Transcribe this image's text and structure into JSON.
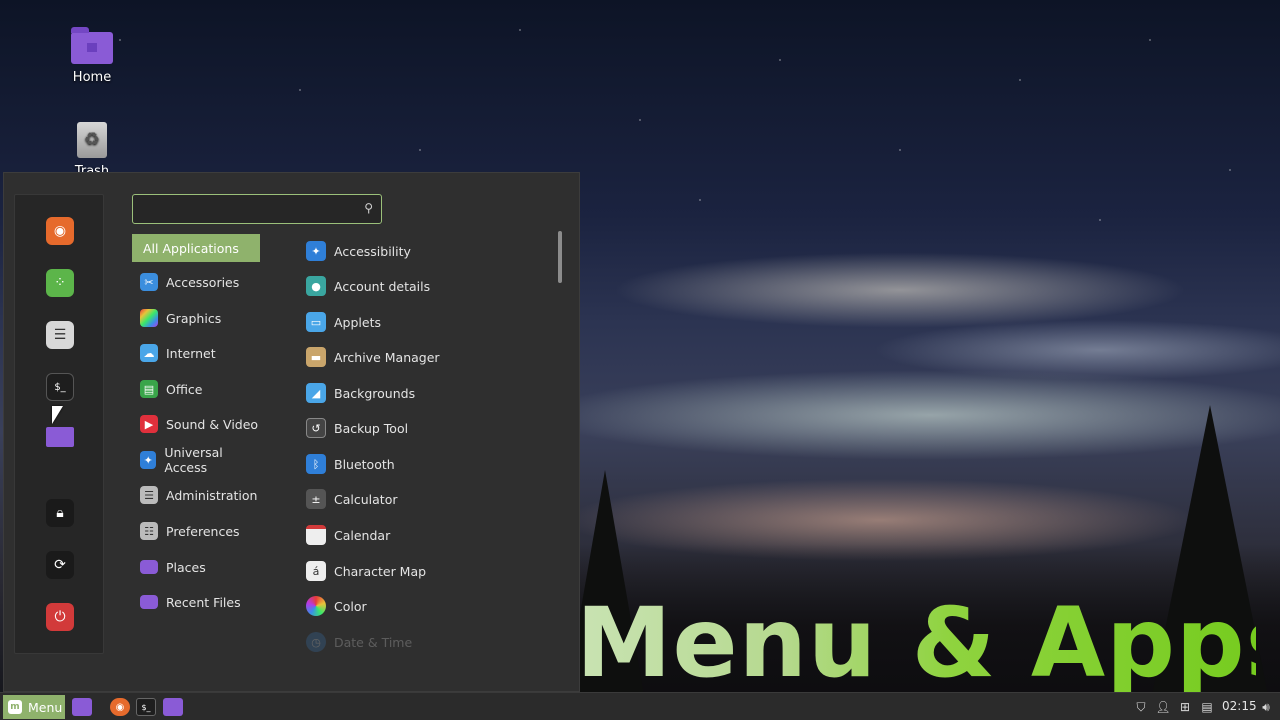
{
  "desktop": {
    "icons": [
      {
        "label": "Home",
        "icon": "folder-home-icon"
      },
      {
        "label": "Trash",
        "icon": "trash-icon"
      }
    ]
  },
  "menu": {
    "search": {
      "value": "",
      "placeholder": "",
      "icon": "search-icon"
    },
    "favorites": [
      {
        "name": "firefox",
        "icon": "firefox-icon",
        "color": "#e66a2c"
      },
      {
        "name": "software-manager",
        "icon": "software-manager-icon",
        "color": "#5cb54a"
      },
      {
        "name": "system-settings",
        "icon": "settings-icon",
        "color": "#d8d8d8"
      },
      {
        "name": "terminal",
        "icon": "terminal-icon",
        "color": "#1e1e1e"
      },
      {
        "name": "files",
        "icon": "folder-icon",
        "color": "#8a5bd6"
      },
      {
        "name": "lock-screen",
        "icon": "lock-icon",
        "color": "#1a1a1a"
      },
      {
        "name": "logout",
        "icon": "logout-icon",
        "color": "#1a1a1a"
      },
      {
        "name": "shutdown",
        "icon": "power-icon",
        "color": "#d23a3a"
      }
    ],
    "categories": [
      {
        "label": "All Applications",
        "icon": "",
        "active": true
      },
      {
        "label": "Accessories",
        "icon": "accessories-icon",
        "color": "#3b8ede"
      },
      {
        "label": "Graphics",
        "icon": "graphics-icon",
        "color": "#c04fb6"
      },
      {
        "label": "Internet",
        "icon": "internet-cloud-icon",
        "color": "#4aa6e8"
      },
      {
        "label": "Office",
        "icon": "office-icon",
        "color": "#3aa54a"
      },
      {
        "label": "Sound & Video",
        "icon": "sound-video-icon",
        "color": "#e0303c"
      },
      {
        "label": "Universal Access",
        "icon": "universal-access-icon",
        "color": "#2f7fd8"
      },
      {
        "label": "Administration",
        "icon": "administration-icon",
        "color": "#bbbbbb"
      },
      {
        "label": "Preferences",
        "icon": "preferences-icon",
        "color": "#bbbbbb"
      },
      {
        "label": "Places",
        "icon": "places-folder-icon",
        "color": "#8a5bd6"
      },
      {
        "label": "Recent Files",
        "icon": "recent-files-icon",
        "color": "#8a5bd6"
      }
    ],
    "apps": [
      {
        "label": "Accessibility",
        "icon": "accessibility-icon",
        "color": "#2f7fd8"
      },
      {
        "label": "Account details",
        "icon": "account-details-icon",
        "color": "#3aa6a0"
      },
      {
        "label": "Applets",
        "icon": "applets-icon",
        "color": "#4aa6e8"
      },
      {
        "label": "Archive Manager",
        "icon": "archive-manager-icon",
        "color": "#c9a56b"
      },
      {
        "label": "Backgrounds",
        "icon": "backgrounds-icon",
        "color": "#4aa6e8"
      },
      {
        "label": "Backup Tool",
        "icon": "backup-tool-icon",
        "color": "#444444"
      },
      {
        "label": "Bluetooth",
        "icon": "bluetooth-icon",
        "color": "#2f7fd8"
      },
      {
        "label": "Calculator",
        "icon": "calculator-icon",
        "color": "#555555"
      },
      {
        "label": "Calendar",
        "icon": "calendar-icon",
        "color": "#eeeeee"
      },
      {
        "label": "Character Map",
        "icon": "character-map-icon",
        "color": "#eeeeee"
      },
      {
        "label": "Color",
        "icon": "color-icon",
        "color": "#555555"
      },
      {
        "label": "Date & Time",
        "icon": "date-time-icon",
        "color": "#3a7bbf"
      }
    ]
  },
  "caption": {
    "text": "Menu & Apps"
  },
  "taskbar": {
    "menu_label": "Menu",
    "launchers": [
      "show-desktop-icon",
      "firefox-icon",
      "terminal-icon",
      "files-folder-icon"
    ],
    "tray_icons": [
      "shield-icon",
      "user-icon",
      "network-icon",
      "clipboard-icon",
      "volume-icon"
    ],
    "clock": "02:15"
  },
  "colors": {
    "accent": "#8fb26c",
    "menu_bg": "#2f2f2f",
    "panel_bg": "#2b2b2b"
  }
}
